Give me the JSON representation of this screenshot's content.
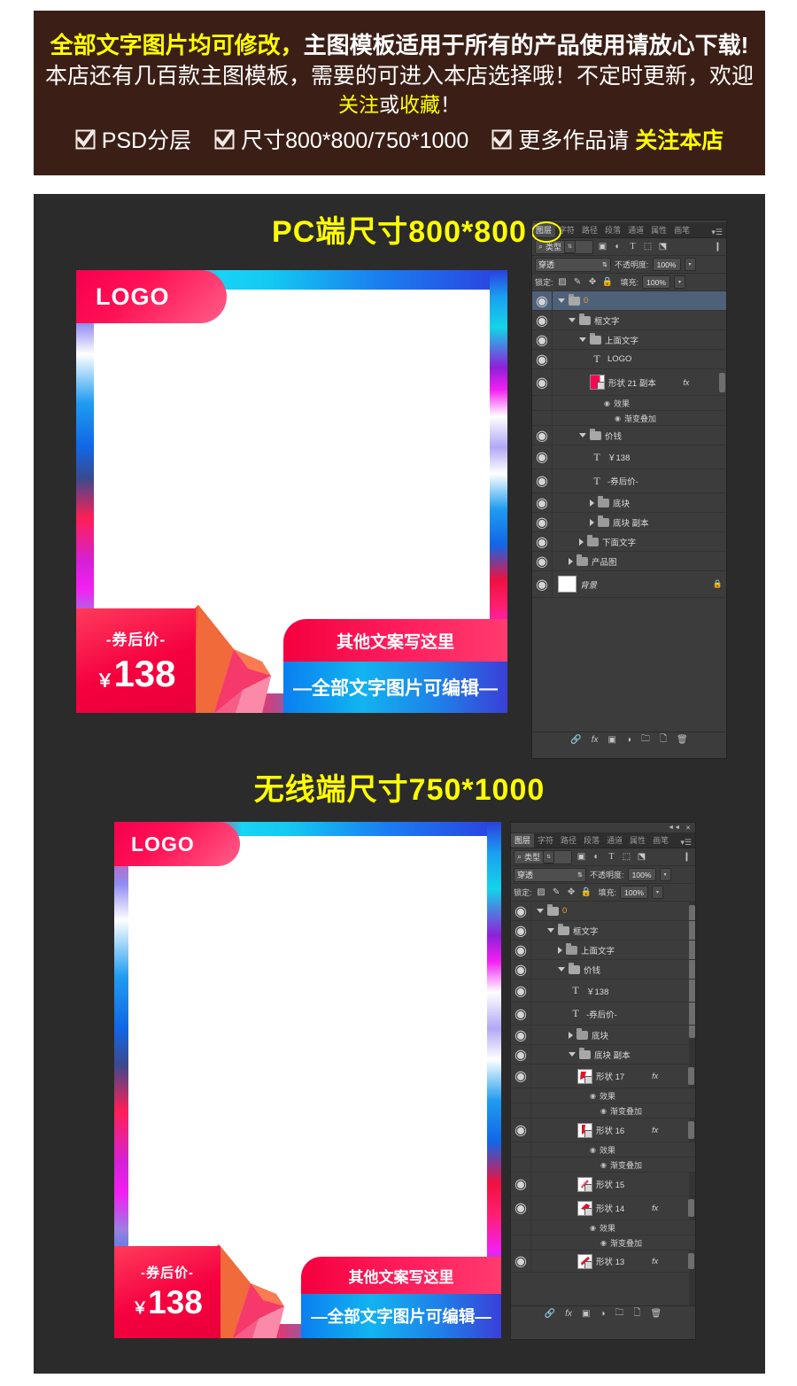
{
  "banner": {
    "line1_highlight": "全部文字图片均可修改，",
    "line1_rest": "主图模板适用于所有的产品使用请放心下载!",
    "line2": "本店还有几百款主图模板，需要的可进入本店选择哦！不定时更新，欢迎",
    "line3_a": "关注",
    "line3_b": "或",
    "line3_c": "收藏",
    "line3_d": "！",
    "features": [
      {
        "icon": "check-box-icon",
        "label": "PSD分层",
        "highlight": ""
      },
      {
        "icon": "check-box-icon",
        "label": "尺寸800*800/750*1000",
        "highlight": ""
      },
      {
        "icon": "check-box-icon",
        "label": "更多作品请",
        "highlight": "关注本店"
      }
    ]
  },
  "sections": {
    "pc_title": "PC端尺寸800*800",
    "mobile_title": "无线端尺寸750*1000"
  },
  "mockup": {
    "logo": "LOGO",
    "price_label": "-券后价-",
    "currency": "￥",
    "price": "138",
    "tag_pink": "其他文案写这里",
    "tag_blue": "—全部文字图片可编辑—"
  },
  "photoshop": {
    "tabs": [
      {
        "label": "图层",
        "active": true
      },
      {
        "label": "字符",
        "active": false
      },
      {
        "label": "路径",
        "active": false
      },
      {
        "label": "段落",
        "active": false
      },
      {
        "label": "通道",
        "active": false
      },
      {
        "label": "属性",
        "active": false
      },
      {
        "label": "画笔",
        "active": false
      }
    ],
    "tab_menu_icon": "panel-menu-icon",
    "filter": {
      "search_icon": "search-icon",
      "label": "类型",
      "stepper_icon": "up-down-arrows-icon",
      "filter_icons": [
        "image-filter-icon",
        "adjustment-filter-icon",
        "type-filter-icon",
        "shape-filter-icon",
        "smart-object-filter-icon"
      ],
      "toggle_icon": "filter-toggle-icon"
    },
    "blend": {
      "mode": "穿透",
      "opacity_label": "不透明度:",
      "opacity_value": "100%"
    },
    "lock": {
      "label": "锁定:",
      "icons": [
        "lock-transparent-icon",
        "lock-image-icon",
        "lock-position-icon",
        "lock-all-icon"
      ],
      "fill_label": "填充:",
      "fill_value": "100%"
    },
    "bottom_icons": [
      "link-layers-icon",
      "layer-style-fx-icon",
      "layer-mask-icon",
      "adjustment-layer-icon",
      "new-group-icon",
      "new-layer-icon",
      "delete-layer-icon"
    ],
    "panel1_layers": [
      {
        "name": "0",
        "type": "group-open",
        "indent": 0,
        "selected": true,
        "eye": true,
        "numeric": true
      },
      {
        "name": "框文字",
        "type": "group-open",
        "indent": 1,
        "eye": true
      },
      {
        "name": "上面文字",
        "type": "group-open",
        "indent": 2,
        "eye": true
      },
      {
        "name": "LOGO",
        "type": "text",
        "indent": 3,
        "eye": true
      },
      {
        "name": "形状 21 副本",
        "type": "shape-pink",
        "indent": 3,
        "eye": true,
        "fx": "fx"
      },
      {
        "name": "效果",
        "type": "effect",
        "indent": 4,
        "eye": true
      },
      {
        "name": "渐变叠加",
        "type": "effect-sub",
        "indent": 5,
        "eye": true
      },
      {
        "name": "价钱",
        "type": "group-open",
        "indent": 2,
        "eye": true
      },
      {
        "name": "￥138",
        "type": "text",
        "indent": 3,
        "eye": true
      },
      {
        "name": "-券后价-",
        "type": "text",
        "indent": 3,
        "eye": true
      },
      {
        "name": "底块",
        "type": "group-closed",
        "indent": 3,
        "eye": true
      },
      {
        "name": "底块 副本",
        "type": "group-closed",
        "indent": 3,
        "eye": true
      },
      {
        "name": "下面文字",
        "type": "group-closed",
        "indent": 2,
        "eye": true
      },
      {
        "name": "产品图",
        "type": "group-closed",
        "indent": 1,
        "eye": true
      },
      {
        "name": "背景",
        "type": "background",
        "indent": 1,
        "eye": true,
        "locked": true
      }
    ],
    "panel2_layers": [
      {
        "name": "0",
        "type": "group-open",
        "indent": 0,
        "eye": true,
        "numeric": true
      },
      {
        "name": "框文字",
        "type": "group-open",
        "indent": 1,
        "eye": true
      },
      {
        "name": "上面文字",
        "type": "group-closed",
        "indent": 2,
        "eye": true
      },
      {
        "name": "价钱",
        "type": "group-open",
        "indent": 2,
        "eye": true
      },
      {
        "name": "￥138",
        "type": "text",
        "indent": 3,
        "eye": true
      },
      {
        "name": "-券后价-",
        "type": "text",
        "indent": 3,
        "eye": true
      },
      {
        "name": "底块",
        "type": "group-closed",
        "indent": 3,
        "eye": true
      },
      {
        "name": "底块 副本",
        "type": "group-open",
        "indent": 3,
        "eye": true
      },
      {
        "name": "形状 17",
        "type": "shape-red",
        "indent": 4,
        "eye": true,
        "fx": "fx"
      },
      {
        "name": "效果",
        "type": "effect",
        "indent": 5,
        "eye": true
      },
      {
        "name": "渐变叠加",
        "type": "effect-sub",
        "indent": 6,
        "eye": true
      },
      {
        "name": "形状 16",
        "type": "shape-red",
        "indent": 4,
        "eye": true,
        "fx": "fx"
      },
      {
        "name": "效果",
        "type": "effect",
        "indent": 5,
        "eye": true
      },
      {
        "name": "渐变叠加",
        "type": "effect-sub",
        "indent": 6,
        "eye": true
      },
      {
        "name": "形状 15",
        "type": "shape-red",
        "indent": 4,
        "eye": true
      },
      {
        "name": "形状 14",
        "type": "shape-red",
        "indent": 4,
        "eye": true,
        "fx": "fx"
      },
      {
        "name": "效果",
        "type": "effect",
        "indent": 5,
        "eye": true
      },
      {
        "name": "渐变叠加",
        "type": "effect-sub",
        "indent": 6,
        "eye": true
      },
      {
        "name": "形状 13",
        "type": "shape-red",
        "indent": 4,
        "eye": true,
        "fx": "fx"
      }
    ]
  },
  "colors": {
    "banner_bg": "#3b1f16",
    "accent_yellow": "#ffff00",
    "workspace_bg": "#2b2b2b",
    "brand_pink": "#f5003f",
    "brand_blue": "#0a7ff0",
    "ps_panel_bg": "#3c3c3c",
    "ps_selected_row": "#4f6179"
  }
}
